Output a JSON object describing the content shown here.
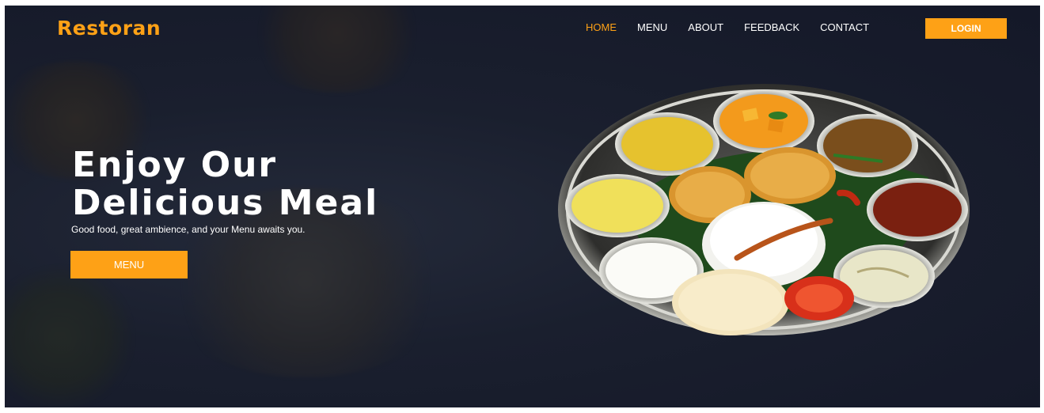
{
  "brand": {
    "name": "Restoran"
  },
  "nav": {
    "items": [
      {
        "label": "HOME",
        "active": true
      },
      {
        "label": "MENU",
        "active": false
      },
      {
        "label": "ABOUT",
        "active": false
      },
      {
        "label": "FEEDBACK",
        "active": false
      },
      {
        "label": "CONTACT",
        "active": false
      }
    ],
    "login_label": "LOGIN"
  },
  "hero": {
    "headline_line1": "Enjoy Our",
    "headline_line2": "Delicious Meal",
    "tagline": "Good food, great ambience, and your Menu awaits you.",
    "cta_label": "MENU"
  },
  "colors": {
    "accent": "#fea116",
    "background": "#1a1f2e",
    "text": "#ffffff"
  },
  "icons": {
    "hero_image": "thali-plate-image"
  }
}
